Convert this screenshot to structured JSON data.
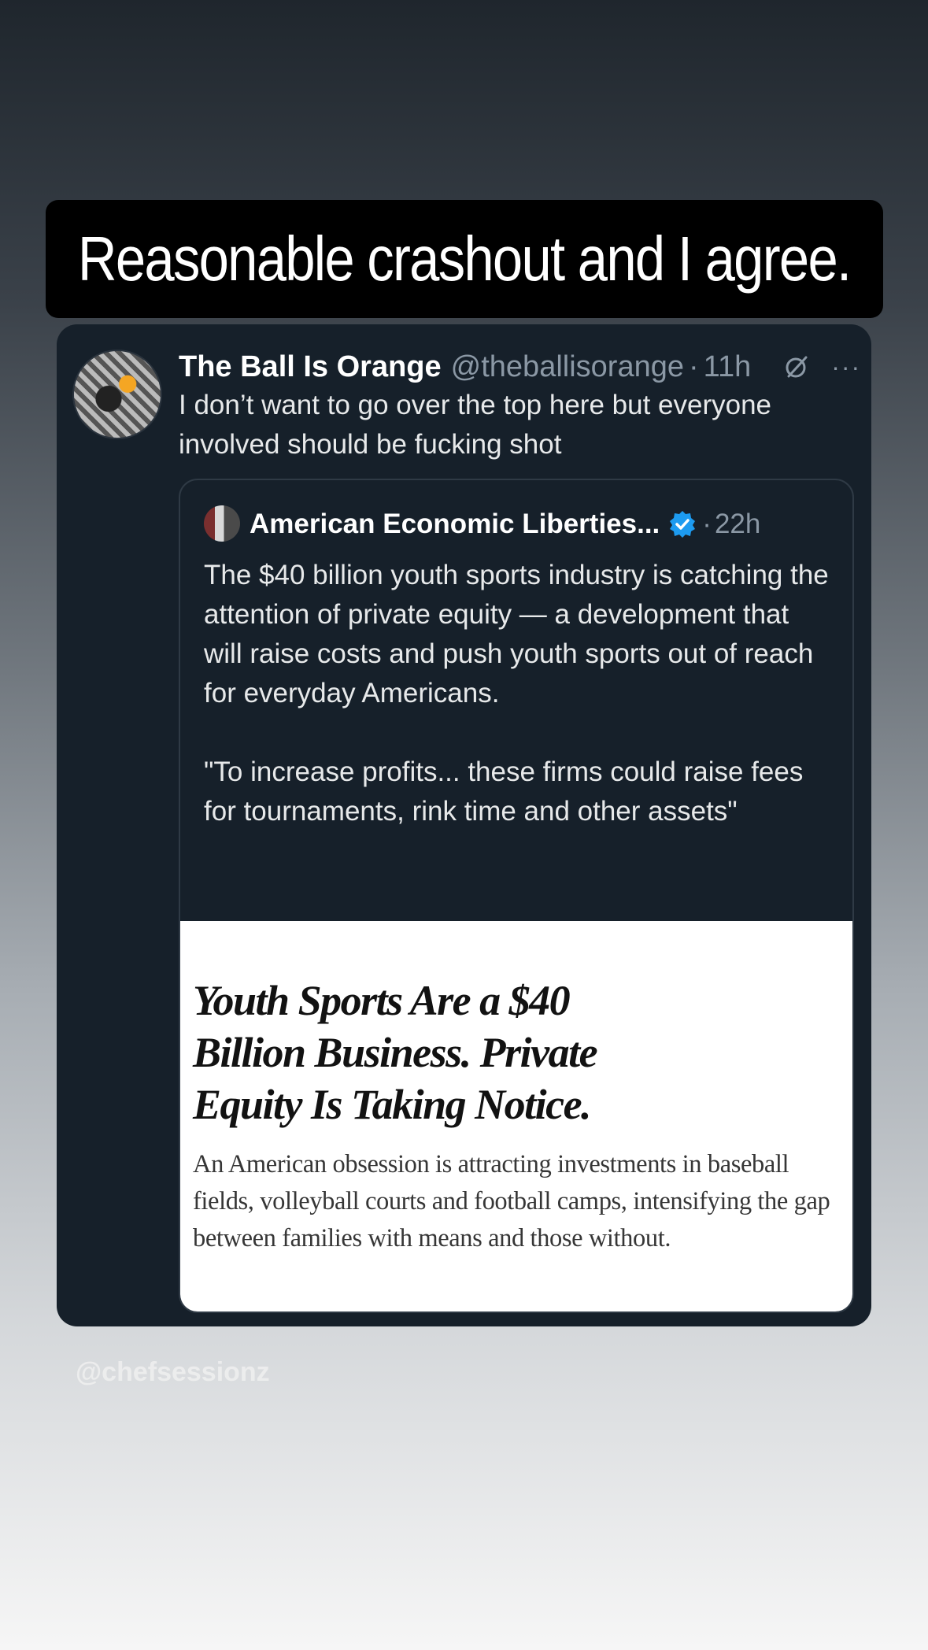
{
  "caption": {
    "text": "Reasonable crashout and I agree."
  },
  "tweet": {
    "author_name": "The Ball Is Orange",
    "author_handle": "@theballisorange",
    "separator": "·",
    "time": "11h",
    "icons": [
      "avatar",
      "grok-icon",
      "more-icon"
    ],
    "more_label": "···",
    "text": "I don’t want to go over the top here but everyone involved should be fucking shot"
  },
  "quote": {
    "author_name": "American Economic Liberties...",
    "verified": true,
    "separator": "·",
    "time": "22h",
    "paragraph_1": "The $40 billion youth sports industry is catching the attention of private equity — a development that will raise costs and push youth sports out of reach for everyday Americans.",
    "paragraph_2": "\"To increase profits... these firms could raise fees for tournaments, rink time and other assets\""
  },
  "article": {
    "headline": "Youth Sports Are a $40 Billion Business. Private Equity Is Taking Notice.",
    "summary": "An American obsession is attracting investments in baseball fields, volleyball courts and football camps, intensifying the gap between families with means and those without."
  },
  "watermark": {
    "text": "@chefsessionz"
  },
  "colors": {
    "card_background": "#16202a",
    "secondary_text": "#8b98a5",
    "verified_blue": "#1d9bf0"
  }
}
